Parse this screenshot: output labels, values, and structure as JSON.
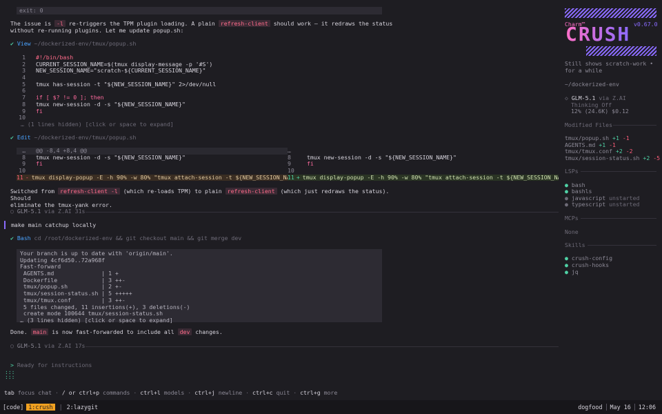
{
  "exit_line": "exit: 0",
  "para1": {
    "a": "The issue is ",
    "flag": "-l",
    "b": " re-triggers the TPM plugin loading. A plain ",
    "cmd": "refresh-client",
    "c": " should work — it redraws the status",
    "line2": "without re-running plugins. Let me update popup.sh:"
  },
  "view_tool": {
    "name": "View",
    "path": "~/dockerized-env/tmux/popup.sh"
  },
  "view_code": [
    {
      "n": "1",
      "t": "#!/bin/bash"
    },
    {
      "n": "2",
      "t": "CURRENT_SESSION_NAME=$(tmux display-message -p '#S')"
    },
    {
      "n": "3",
      "t": "NEW_SESSION_NAME=\"scratch-${CURRENT_SESSION_NAME}\""
    },
    {
      "n": "4",
      "t": ""
    },
    {
      "n": "5",
      "t": "tmux has-session -t \"${NEW_SESSION_NAME}\" 2>/dev/null"
    },
    {
      "n": "6",
      "t": ""
    },
    {
      "n": "7",
      "t": "if [ $? != 0 ]; then"
    },
    {
      "n": "8",
      "t": "  tmux new-session -d -s \"${NEW_SESSION_NAME}\""
    },
    {
      "n": "9",
      "t": "fi"
    },
    {
      "n": "10",
      "t": ""
    }
  ],
  "view_hidden": "… (1 lines hidden) [click or space to expand]",
  "edit_tool": {
    "name": "Edit",
    "path": "~/dockerized-env/tmux/popup.sh"
  },
  "diff": {
    "hunk": "@@ -8,4 +8,4 @@",
    "left_ell": "…",
    "right_ell": "…",
    "rows": [
      {
        "ln": "8",
        "t": "  tmux new-session -d -s \"${NEW_SESSION_NAME}\"",
        "rn": "8",
        "rt": "  tmux new-session -d -s \"${NEW_SESSION_NAME}\""
      },
      {
        "ln": "9",
        "t": "fi",
        "rn": "9",
        "rt": "fi"
      },
      {
        "ln": "10",
        "t": "",
        "rn": "10",
        "rt": ""
      }
    ],
    "del": {
      "ln": "11",
      "sign": "-",
      "t": "tmux display-popup -E -h 90% -w 80% \"tmux attach-session -t ${NEW_SESSION_NAME}…"
    },
    "add": {
      "ln": "11",
      "sign": "+",
      "t": "tmux display-popup -E -h 90% -w 80% \"tmux attach-session -t ${NEW_SESSION_NAME}…"
    }
  },
  "para2": {
    "a": "Switched from ",
    "cmd1": "refresh-client -l",
    "b": " (which re-loads TPM) to plain ",
    "cmd2": "refresh-client",
    "c": " (which just redraws the status). Should",
    "line2": "eliminate the tmux-yank error."
  },
  "model_sep1": {
    "model": "GLM-5.1",
    "rest": " via Z.AI 31s"
  },
  "user_message": "make main catchup locally",
  "bash_tool": {
    "name": "Bash",
    "cmd": "cd /root/dockerized-env && git checkout main && git merge dev"
  },
  "bash_output": [
    "Your branch is up to date with 'origin/main'.",
    "Updating 4cf6d50..72a968f",
    "Fast-forward",
    " AGENTS.md              | 1 +",
    " Dockerfile             | 3 ++-",
    " tmux/popup.sh          | 2 +-",
    " tmux/session-status.sh | 5 +++++",
    " tmux/tmux.conf         | 3 ++-",
    " 5 files changed, 11 insertions(+), 3 deletions(-)",
    " create mode 100644 tmux/session-status.sh",
    "… (3 lines hidden) [click or space to expand]"
  ],
  "para3": {
    "a": "Done. ",
    "branch": "main",
    "b": " is now fast-forwarded to include all ",
    "branch2": "dev",
    "c": " changes."
  },
  "model_sep2": {
    "model": "GLM-5.1",
    "rest": " via Z.AI 17s"
  },
  "prompt": {
    "symbol": ">",
    "placeholder": "Ready for instructions"
  },
  "help": {
    "k1": "tab",
    "d1": "focus chat",
    "k2": "/ or ctrl+p",
    "d2": "commands",
    "k3": "ctrl+l",
    "d3": "models",
    "k4": "ctrl+j",
    "d4": "newline",
    "k5": "ctrl+c",
    "d5": "quit",
    "k6": "ctrl+g",
    "d6": "more"
  },
  "statusbar": {
    "session": "[code]",
    "win1": "1:crush",
    "win2": "2:lazygit",
    "host": "dogfood",
    "date": "May 16",
    "time": "12:06"
  },
  "sidebar": {
    "brand": "Charm™",
    "version": "v0.67.0",
    "logo": "CRUSH",
    "summary": "Still shows scratch-work • for a while",
    "cwd": "~/dockerized-env",
    "model": "GLM-5.1",
    "provider": "via Z.AI",
    "thinking": "Thinking Off",
    "usage": "12% (24.6K) $0.12",
    "modified_title": "Modified Files",
    "files": [
      {
        "name": "tmux/popup.sh",
        "add": "+1",
        "del": "-1"
      },
      {
        "name": "AGENTS.md",
        "add": "+1",
        "del": "-1"
      },
      {
        "name": "tmux/tmux.conf",
        "add": "+2",
        "del": "-2"
      },
      {
        "name": "tmux/session-status.sh",
        "add": "+2",
        "del": "-5"
      }
    ],
    "lsps_title": "LSPs",
    "lsps": [
      {
        "name": "bash",
        "status": ""
      },
      {
        "name": "bashls",
        "status": ""
      },
      {
        "name": "javascript",
        "status": "unstarted"
      },
      {
        "name": "typescript",
        "status": "unstarted"
      }
    ],
    "mcps_title": "MCPs",
    "mcps_none": "None",
    "skills_title": "Skills",
    "skills": [
      "crush-config",
      "crush-hooks",
      "jq"
    ]
  },
  "colors": {
    "accent": "#8a6bff",
    "pink": "#ff70c8",
    "green": "#4fd1a5",
    "orange": "#f0a020",
    "bg": "#1e1d22"
  }
}
